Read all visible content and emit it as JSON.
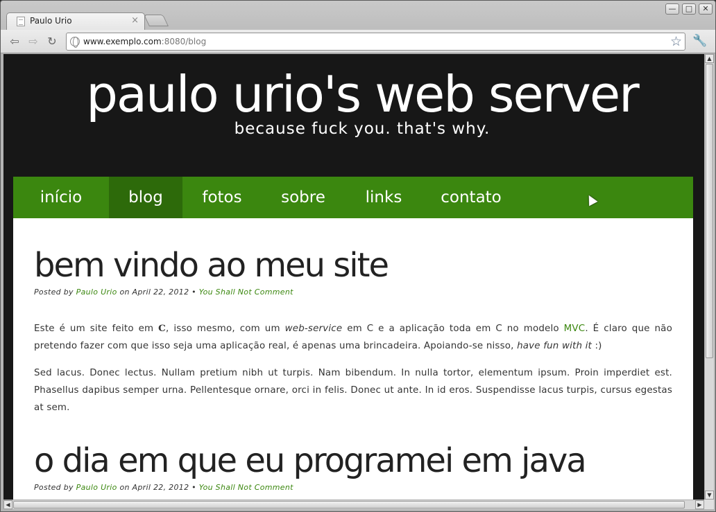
{
  "browser": {
    "tab_title": "Paulo Urio",
    "tab_close": "×",
    "url_host": "www.exemplo.com",
    "url_rest": ":8080/blog",
    "window_buttons": [
      "—",
      "□",
      "✕"
    ]
  },
  "header": {
    "title": "paulo urio's web server",
    "tagline": "because fuck you. that's why."
  },
  "nav": {
    "items": [
      "início",
      "blog",
      "fotos",
      "sobre",
      "links",
      "contato"
    ],
    "active": "blog"
  },
  "posts": [
    {
      "title": "bem vindo ao meu site",
      "meta_posted_by": "Posted by",
      "meta_author": "Paulo Urio",
      "meta_on": "on April 22, 2012  •",
      "meta_comments": "You Shall Not Comment",
      "p1_a": "Este é um site feito em ",
      "p1_c": "C",
      "p1_b": ", isso mesmo, com um ",
      "p1_ws": "web-service",
      "p1_d": " em C e a aplicação toda em C no modelo ",
      "p1_mvc": "MVC",
      "p1_e": ". É claro que não pretendo fazer com que isso seja uma aplicação real, é apenas uma brincadeira. Apoiando-se nisso, ",
      "p1_fun": "have fun with it",
      "p1_f": " :)",
      "p2": "Sed lacus. Donec lectus. Nullam pretium nibh ut turpis. Nam bibendum. In nulla tortor, elementum ipsum. Proin imperdiet est. Phasellus dapibus semper urna. Pellentesque ornare, orci in felis. Donec ut ante. In id eros. Suspendisse lacus turpis, cursus egestas at sem."
    },
    {
      "title": "o dia em que eu programei em java",
      "meta_posted_by": "Posted by",
      "meta_author": "Paulo Urio",
      "meta_on": "on April 22, 2012  •",
      "meta_comments": "You Shall Not Comment"
    }
  ],
  "colors": {
    "accent_green": "#3b870f",
    "active_nav": "#2d6a0a",
    "header_bg": "#171717"
  }
}
